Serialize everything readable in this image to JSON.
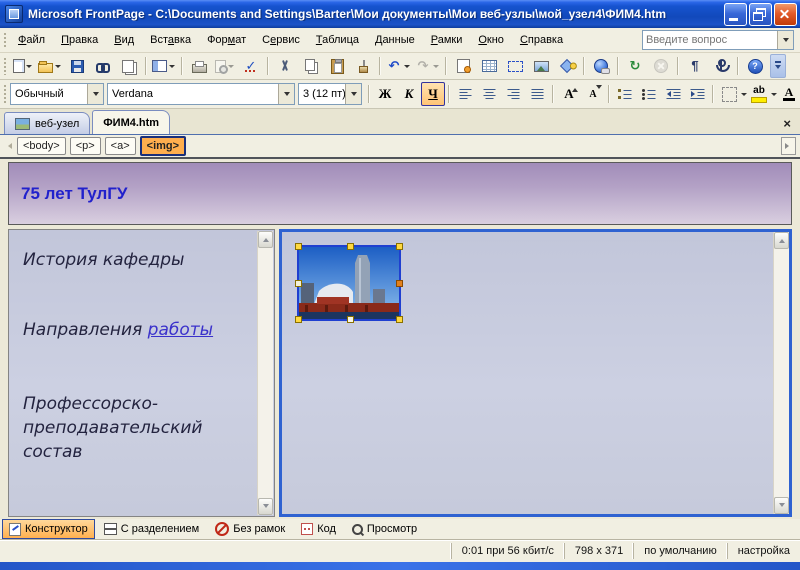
{
  "window": {
    "title": "Microsoft FrontPage - C:\\Documents and Settings\\Barter\\Мои документы\\Мои веб-узлы\\мой_узел4\\ФИМ4.htm"
  },
  "ui": {
    "close_glyph": "×",
    "question_placeholder": "Введите вопрос"
  },
  "menu": {
    "items": [
      {
        "id": "file",
        "pre": "",
        "key": "Ф",
        "post": "айл"
      },
      {
        "id": "edit",
        "pre": "",
        "key": "П",
        "post": "равка"
      },
      {
        "id": "view",
        "pre": "",
        "key": "В",
        "post": "ид"
      },
      {
        "id": "insert",
        "pre": "Вст",
        "key": "а",
        "post": "вка"
      },
      {
        "id": "format",
        "pre": "Фор",
        "key": "м",
        "post": "ат"
      },
      {
        "id": "tools",
        "pre": "С",
        "key": "е",
        "post": "рвис"
      },
      {
        "id": "table",
        "pre": "",
        "key": "Т",
        "post": "аблица"
      },
      {
        "id": "data",
        "pre": "",
        "key": "Д",
        "post": "анные"
      },
      {
        "id": "frames",
        "pre": "",
        "key": "Р",
        "post": "амки"
      },
      {
        "id": "window",
        "pre": "",
        "key": "О",
        "post": "кно"
      },
      {
        "id": "help",
        "pre": "",
        "key": "С",
        "post": "правка"
      }
    ]
  },
  "toolbar1": {
    "items": [
      {
        "name": "new-document",
        "dd": true
      },
      {
        "name": "open-folder",
        "dd": true
      },
      {
        "name": "save"
      },
      {
        "name": "find"
      },
      {
        "name": "publish"
      },
      {
        "sep": true
      },
      {
        "name": "toggle-pane",
        "dd": true
      },
      {
        "sep": true
      },
      {
        "name": "print"
      },
      {
        "name": "print-preview",
        "dd": true,
        "disabled": true
      },
      {
        "name": "spelling",
        "g": "✓"
      },
      {
        "sep": true
      },
      {
        "name": "cut"
      },
      {
        "name": "copy"
      },
      {
        "name": "paste"
      },
      {
        "name": "format-painter"
      },
      {
        "sep": true
      },
      {
        "name": "undo",
        "g": "↶",
        "dd": true
      },
      {
        "name": "redo",
        "g": "↷",
        "dd": true,
        "disabled": true
      },
      {
        "sep": true
      },
      {
        "name": "insert-component"
      },
      {
        "name": "insert-table"
      },
      {
        "name": "insert-layer"
      },
      {
        "name": "insert-picture"
      },
      {
        "name": "drawing"
      },
      {
        "sep": true
      },
      {
        "name": "insert-hyperlink"
      },
      {
        "sep": true
      },
      {
        "name": "refresh",
        "g": "↻"
      },
      {
        "name": "stop",
        "disabled": true
      },
      {
        "sep": true
      },
      {
        "name": "paragraph-marks",
        "g": "¶"
      },
      {
        "name": "bookmark"
      },
      {
        "sep": true
      },
      {
        "name": "help",
        "g": "?"
      }
    ]
  },
  "toolbar2": {
    "style": "Обычный",
    "font": "Verdana",
    "size": "3 (12 пт)",
    "bold": "Ж",
    "italic": "К",
    "underline": "Ч",
    "grow": "А",
    "shrink": "А",
    "highlight": "ab",
    "fontcolor": "А"
  },
  "tabs": {
    "items": [
      {
        "id": "website",
        "label": "веб-узел",
        "icon": "web-site",
        "active": false
      },
      {
        "id": "page",
        "label": "ФИМ4.htm",
        "active": true
      }
    ]
  },
  "tagbar": {
    "tags": [
      {
        "label": "<body>",
        "active": false
      },
      {
        "label": "<p>",
        "active": false
      },
      {
        "label": "<a>",
        "active": false
      },
      {
        "label": "<img>",
        "active": true
      }
    ]
  },
  "document": {
    "header_title": "75 лет ТулГУ",
    "nav": {
      "item1": "История кафедры",
      "item2_pre": "Направления ",
      "item2_link": "работы",
      "item3": "Профессорско-\nпреподавательский\nсостав"
    }
  },
  "view_tabs": {
    "items": [
      {
        "id": "design",
        "label": "Конструктор",
        "active": true
      },
      {
        "id": "split",
        "label": "С разделением",
        "active": false
      },
      {
        "id": "noframes",
        "label": "Без рамок",
        "active": false
      },
      {
        "id": "code",
        "label": "Код",
        "active": false
      },
      {
        "id": "preview",
        "label": "Просмотр",
        "active": false
      }
    ]
  },
  "statusbar": {
    "cells": [
      {
        "id": "download-time",
        "text": "0:01 при 56 кбит/с"
      },
      {
        "id": "page-size",
        "text": "798 x 371"
      },
      {
        "id": "color-schema",
        "text": "по умолчанию"
      },
      {
        "id": "custom",
        "text": "настройка"
      }
    ]
  },
  "colors": {
    "accent_orange": "#ffae4e",
    "selection_blue": "#1f3fd0",
    "frame_active_border": "#2f62d1",
    "header_text": "#2121cc",
    "link": "#3a31cb",
    "titlebar_blue": "#1149bb"
  }
}
